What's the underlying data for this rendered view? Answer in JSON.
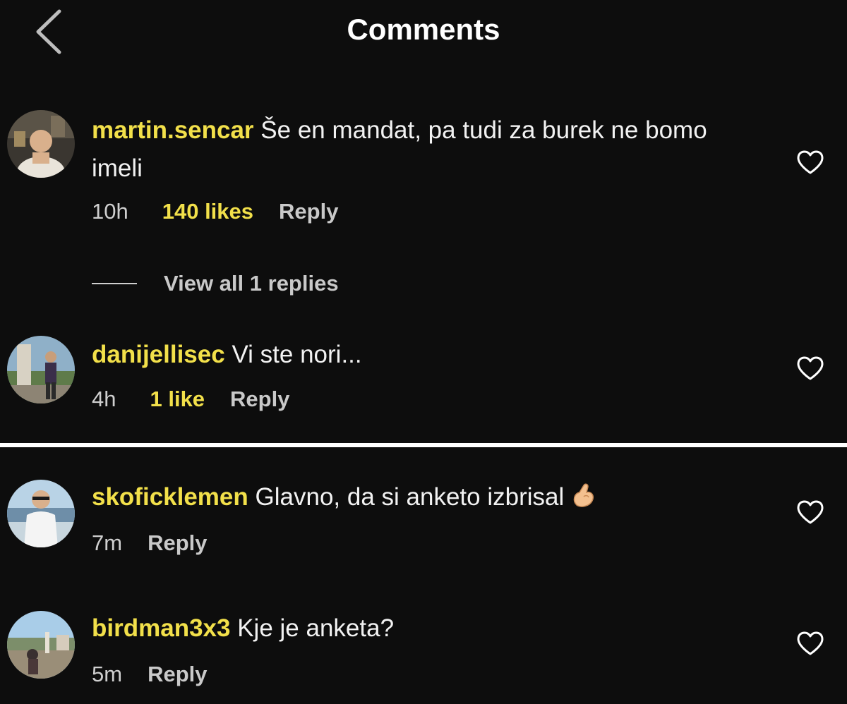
{
  "header": {
    "title": "Comments",
    "back_icon": "chevron-left-icon"
  },
  "colors": {
    "background": "#0d0d0d",
    "username": "#f2e04a",
    "likes": "#f2e04a",
    "text": "#f2f2f2",
    "muted": "#c9c9c9",
    "separator": "#ffffff"
  },
  "comments": [
    {
      "username": "martin.sencar",
      "text": "Še en mandat, pa tudi za burek ne bomo imeli",
      "time": "10h",
      "likes": "140 likes",
      "reply": "Reply",
      "view_replies": "View all 1 replies",
      "icon": "heart-outline-icon"
    },
    {
      "username": "danijellisec",
      "text": "Vi ste nori...",
      "time": "4h",
      "likes": "1 like",
      "reply": "Reply",
      "icon": "heart-outline-icon"
    },
    {
      "username": "skoficklemen",
      "text": "Glavno, da si anketo izbrisal",
      "emoji": "pinching-hand-emoji",
      "time": "7m",
      "reply": "Reply",
      "icon": "heart-outline-icon"
    },
    {
      "username": "birdman3x3",
      "text": "Kje je anketa?",
      "time": "5m",
      "reply": "Reply",
      "icon": "heart-outline-icon"
    }
  ]
}
